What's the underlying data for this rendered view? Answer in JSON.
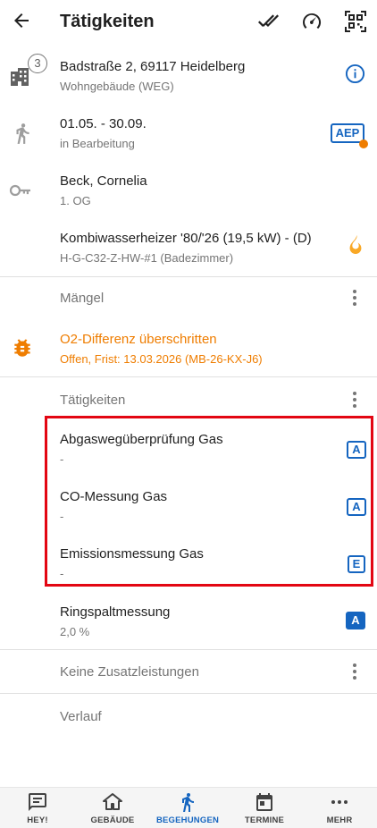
{
  "appbar": {
    "title": "Tätigkeiten"
  },
  "address": {
    "count": "3",
    "street": "Badstraße 2, 69117 Heidelberg",
    "type": "Wohngebäude (WEG)"
  },
  "visit": {
    "period": "01.05. - 30.09.",
    "status": "in Bearbeitung",
    "badge": "AEP"
  },
  "contact": {
    "name": "Beck, Cornelia",
    "floor": "1. OG"
  },
  "device": {
    "name": "Kombiwasserheizer '80/'26 (19,5 kW) - (D)",
    "id": "H-G-C32-Z-HW-#1 (Badezimmer)"
  },
  "maengel": {
    "title": "Mängel"
  },
  "defect": {
    "title": "O2-Differenz überschritten",
    "detail": "Offen, Frist: 13.03.2026 (MB-26-KX-J6)"
  },
  "taetigkeiten": {
    "title": "Tätigkeiten",
    "items": [
      {
        "name": "Abgaswegüberprüfung Gas",
        "value": "-",
        "badge": "A"
      },
      {
        "name": "CO-Messung Gas",
        "value": "-",
        "badge": "A"
      },
      {
        "name": "Emissionsmessung Gas",
        "value": "-",
        "badge": "E"
      },
      {
        "name": "Ringspaltmessung",
        "value": "2,0 %",
        "badge": "A"
      }
    ]
  },
  "zusatz": {
    "title": "Keine Zusatzleistungen"
  },
  "verlauf": {
    "title": "Verlauf"
  },
  "nav": {
    "items": [
      {
        "label": "HEY!"
      },
      {
        "label": "GEBÄUDE"
      },
      {
        "label": "BEGEHUNGEN"
      },
      {
        "label": "TERMINE"
      },
      {
        "label": "MEHR"
      }
    ]
  },
  "colors": {
    "accent": "#1565c0",
    "warning": "#ef7d00",
    "highlight": "#e30613"
  }
}
